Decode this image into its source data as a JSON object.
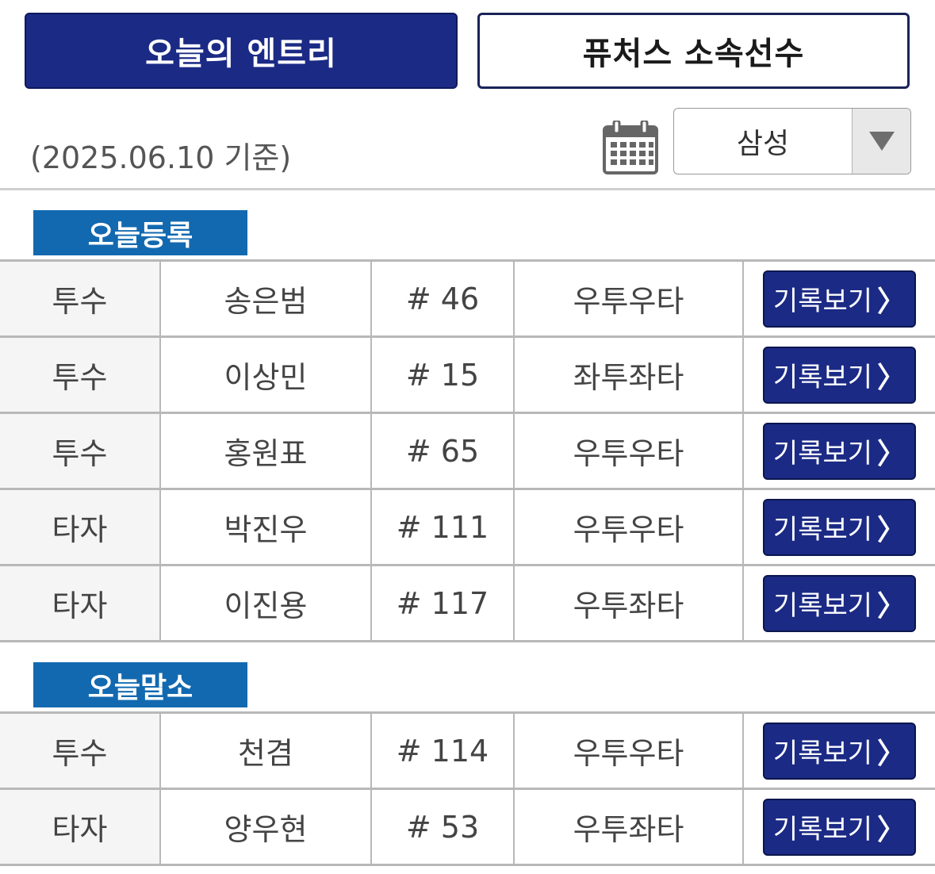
{
  "tabs": {
    "active_label": "오늘의 엔트리",
    "inactive_label": "퓨처스 소속선수"
  },
  "date_label": "(2025.06.10 기준)",
  "team_select": {
    "value": "삼성"
  },
  "colors": {
    "navy": "#1b2a85",
    "section_blue": "#1269b0"
  },
  "sections": [
    {
      "label": "오늘등록",
      "rows": [
        {
          "position": "투수",
          "name": "송은범",
          "number": "# 46",
          "hand": "우투우타",
          "button": "기록보기"
        },
        {
          "position": "투수",
          "name": "이상민",
          "number": "# 15",
          "hand": "좌투좌타",
          "button": "기록보기"
        },
        {
          "position": "투수",
          "name": "홍원표",
          "number": "# 65",
          "hand": "우투우타",
          "button": "기록보기"
        },
        {
          "position": "타자",
          "name": "박진우",
          "number": "# 111",
          "hand": "우투우타",
          "button": "기록보기"
        },
        {
          "position": "타자",
          "name": "이진용",
          "number": "# 117",
          "hand": "우투좌타",
          "button": "기록보기"
        }
      ]
    },
    {
      "label": "오늘말소",
      "rows": [
        {
          "position": "투수",
          "name": "천겸",
          "number": "# 114",
          "hand": "우투우타",
          "button": "기록보기"
        },
        {
          "position": "타자",
          "name": "양우현",
          "number": "# 53",
          "hand": "우투좌타",
          "button": "기록보기"
        }
      ]
    }
  ],
  "icons": {
    "calendar": "calendar-icon",
    "dropdown": "triangle-down-icon",
    "chevron": "chevron-right-icon"
  }
}
